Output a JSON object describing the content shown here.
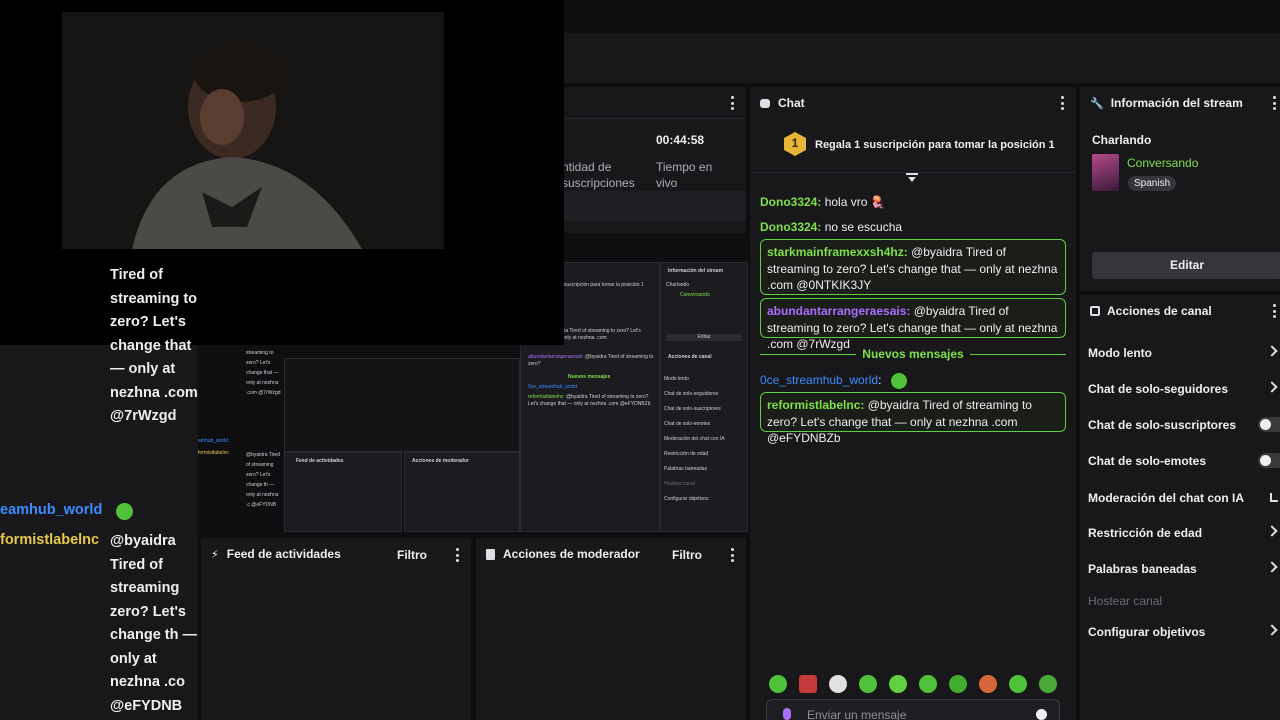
{
  "top_panel": {
    "timer": "00:44:58",
    "timer_label": "Tiempo en vivo",
    "subs_label": "ntidad de suscripciones"
  },
  "chat": {
    "title": "Chat",
    "gift_banner": "Regala 1 suscripción para tomar la posición 1",
    "gift_rank": "1",
    "messages": [
      {
        "user": "Dono3324:",
        "text": " hola vro 🪼"
      },
      {
        "user": "Dono3324:",
        "text": " no se escucha"
      },
      {
        "user": "starkmainframexxsh4hz:",
        "text": " @byaidra Tired of streaming to zero? Let's change that — only at nezhna .com @0NTKIK3JY"
      },
      {
        "user": "abundantarrangeraesais:",
        "text": " @byaidra Tired of streaming to zero? Let's change that — only at nezhna .com @7rWzgd"
      },
      {
        "user": "0ce_streamhub_world",
        "text": ":"
      },
      {
        "user": "reformistlabelnc:",
        "text": " @byaidra Tired of streaming to zero? Let's change that — only at nezhna .com @eFYDNBZb"
      }
    ],
    "new_messages_divider": "Nuevos mensajes",
    "input_placeholder": "Enviar un mensaje"
  },
  "stream_info": {
    "title": "Información del stream",
    "stream_title": "Charlando",
    "category": "Conversando",
    "tag": "Spanish",
    "edit_button": "Editar"
  },
  "channel_actions": {
    "title": "Acciones de canal",
    "items": [
      {
        "label": "Modo lento",
        "control": "chevron"
      },
      {
        "label": "Chat de solo-seguidores",
        "control": "chevron"
      },
      {
        "label": "Chat de solo-suscriptores",
        "control": "toggle"
      },
      {
        "label": "Chat de solo-emotes",
        "control": "toggle"
      },
      {
        "label": "Moderación del chat con IA",
        "control": "external"
      },
      {
        "label": "Restricción de edad",
        "control": "chevron"
      },
      {
        "label": "Palabras baneadas",
        "control": "chevron"
      },
      {
        "label": "Hostear canal",
        "control": "disabled"
      },
      {
        "label": "Configurar objetivos",
        "control": "chevron"
      }
    ]
  },
  "activity_feed": {
    "title": "Feed de actividades",
    "filter": "Filtro"
  },
  "mod_actions": {
    "title": "Acciones de moderador",
    "filter": "Filtro"
  },
  "overlay_chat": {
    "fragment_1": "Tired of streaming to zero? Let's change that — only at nezhna .com @7rWzgd",
    "user_1": "eamhub_world",
    "user_2": "formistlabelnc",
    "fragment_2": "@byaidra Tired of streaming zero? Let's change th — only at nezhna .co @eFYDNB"
  },
  "colors": {
    "accent_green": "#7fe04a",
    "purple": "#a970ff",
    "bg": "#18181b"
  }
}
